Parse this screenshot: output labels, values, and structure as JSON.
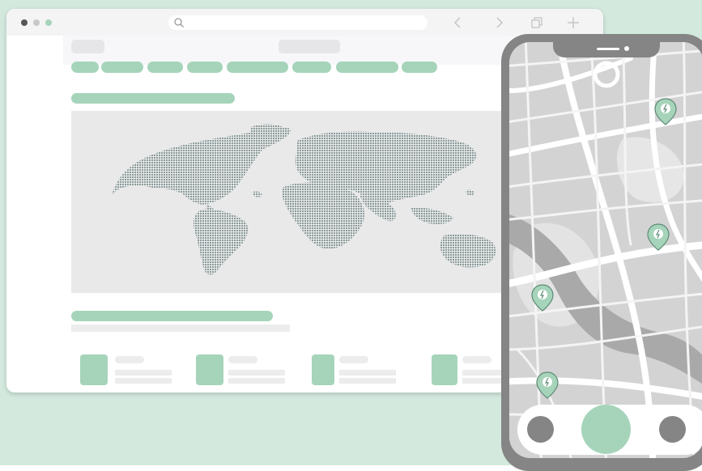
{
  "colors": {
    "background": "#d3e9de",
    "accent": "#a6d4bb",
    "pin_fill": "#a6d4bb",
    "dotmap": "#8a9a9a",
    "phone_frame": "#858585"
  },
  "browser": {
    "window_controls": [
      "close-dot",
      "minimize-dot",
      "maximize-dot"
    ],
    "icons": [
      "search-icon",
      "back-icon",
      "forward-icon",
      "tabs-icon",
      "new-tab-icon"
    ]
  },
  "phone": {
    "map_pins": 4,
    "controls": [
      "left-button",
      "center-button",
      "right-button"
    ]
  }
}
